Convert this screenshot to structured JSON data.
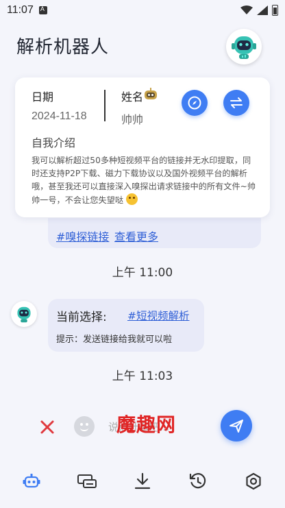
{
  "status_bar": {
    "time": "11:07"
  },
  "header": {
    "title": "解析机器人"
  },
  "profile": {
    "date_label": "日期",
    "date_value": "2024-11-18",
    "name_label": "姓名",
    "name_value": "帅帅",
    "intro_label": "自我介绍",
    "intro_text": "我可以解析超过50多种短视频平台的链接并无水印提取，同时还支持P2P下载、磁力下载协议以及国外视频平台的解析哦，甚至我还可以直接深入嗅探出请求链接中的所有文件~帅帅一号，不会让您失望哒"
  },
  "prev_bubble": {
    "link1": "#嗅探链接",
    "link2": "查看更多"
  },
  "chat": {
    "time1": "上午 11:00",
    "current_label": "当前选择:",
    "current_link": "#短视频解析",
    "hint": "提示：发送链接给我就可以啦",
    "time2": "上午 11:03"
  },
  "input": {
    "placeholder": "说点什么吧...",
    "watermark": "魔趣网"
  },
  "colors": {
    "accent": "#3f7df3",
    "bubble": "#e8eaf8",
    "danger": "#e0393e"
  },
  "nav": [
    {
      "icon": "robot-icon",
      "active": true
    },
    {
      "icon": "devices-icon",
      "active": false
    },
    {
      "icon": "download-icon",
      "active": false
    },
    {
      "icon": "history-icon",
      "active": false
    },
    {
      "icon": "settings-icon",
      "active": false
    }
  ]
}
